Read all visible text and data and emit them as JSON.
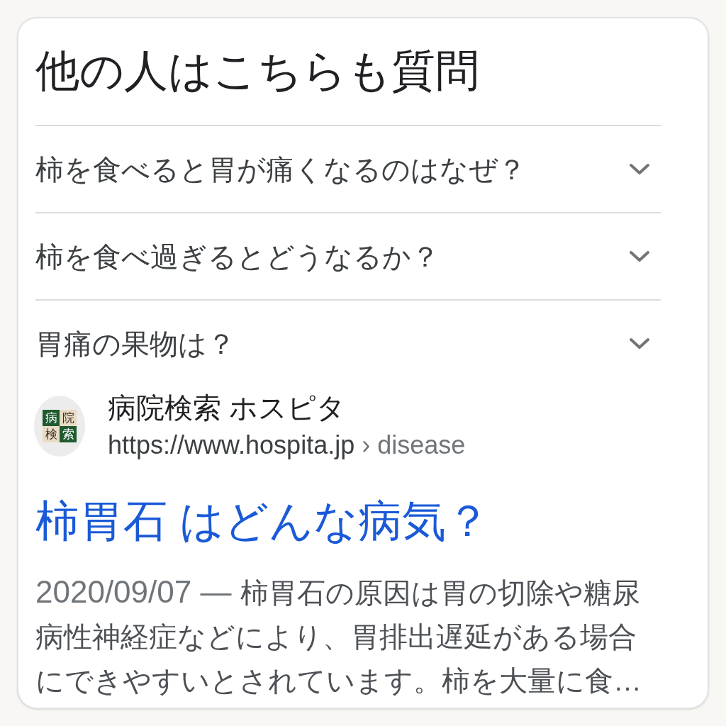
{
  "section": {
    "title": "他の人はこちらも質問"
  },
  "questions": [
    {
      "text": "柿を食べると胃が痛くなるのはなぜ？",
      "expanded": false
    },
    {
      "text": "柿を食べ過ぎるとどうなるか？",
      "expanded": false
    },
    {
      "text": "胃痛の果物は？",
      "expanded": false
    }
  ],
  "result": {
    "logo_tiles": [
      {
        "text": "病",
        "color": "#1f5a30"
      },
      {
        "text": "院",
        "color": "#e9dcc4"
      },
      {
        "text": "検",
        "color": "#e9dcc4"
      },
      {
        "text": "索",
        "color": "#1f5a30"
      }
    ],
    "site_name": "病院検索 ホスピタ",
    "url": "https://www.hospita.jp",
    "path": "› disease",
    "title": "柿胃石 はどんな病気？",
    "date": "2020/09/07 —",
    "snippet": "柿胃石の原因は胃の切除や糖尿病性神経症などにより、胃排出遅延がある場合にできやすいとされています。柿を大量に食…"
  }
}
